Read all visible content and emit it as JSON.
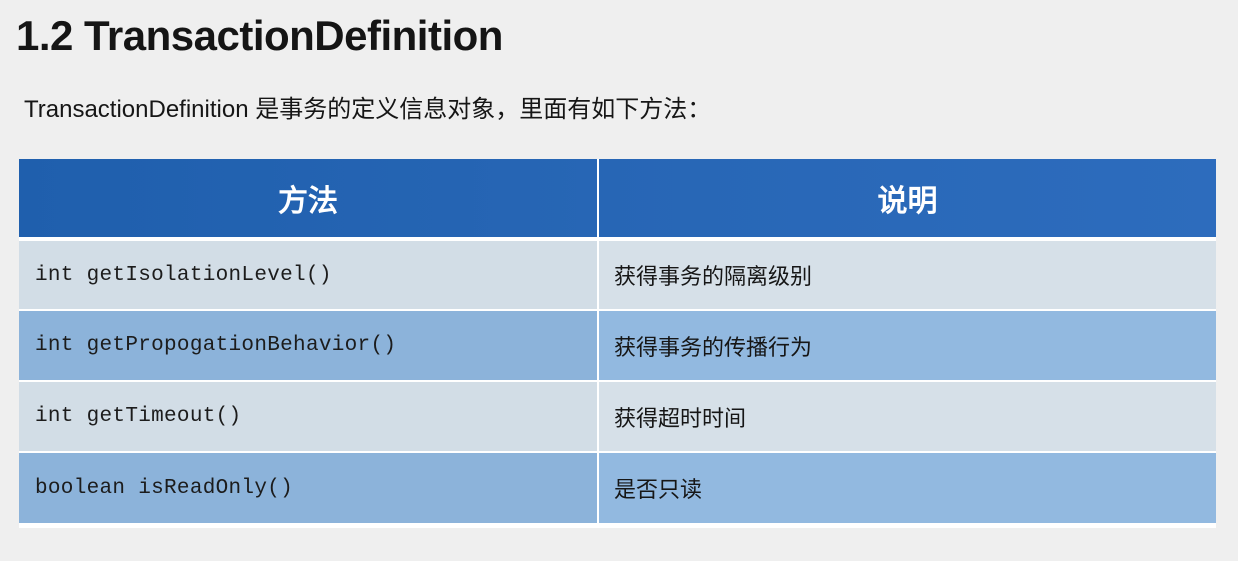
{
  "page": {
    "title": "1.2 TransactionDefinition",
    "subtitle": "TransactionDefinition 是事务的定义信息对象，里面有如下方法："
  },
  "table": {
    "headers": [
      "方法",
      "说明"
    ],
    "rows": [
      {
        "method": "int getIsolationLevel()",
        "description": "获得事务的隔离级别"
      },
      {
        "method": "int getPropogationBehavior()",
        "description": "获得事务的传播行为"
      },
      {
        "method": "int getTimeout()",
        "description": "获得超时时间"
      },
      {
        "method": "boolean isReadOnly()",
        "description": "是否只读"
      }
    ]
  },
  "colors": {
    "header_bg": "#2161b0",
    "row_light": "#d2dde6",
    "row_dark": "#8cb3da",
    "page_bg": "#efefef"
  }
}
